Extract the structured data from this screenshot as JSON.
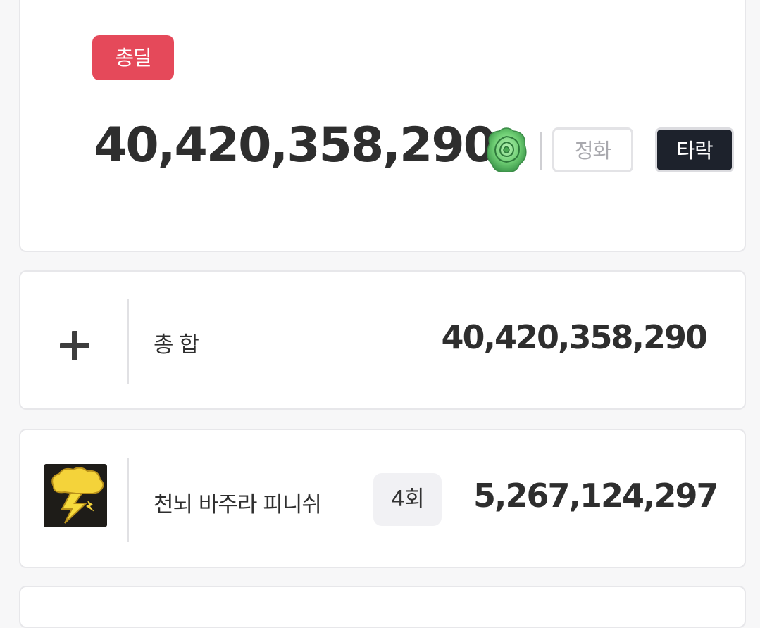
{
  "total": {
    "badge_label": "총딜",
    "value": "40,420,358,290",
    "rose_icon": "green-rose-icon",
    "purify_label": "정화",
    "corrupt_label": "타락",
    "badge_color": "#e5495a",
    "active_toggle_color": "#1d222c"
  },
  "summary": {
    "icon": "plus-icon",
    "label": "총 합",
    "value": "40,420,358,290"
  },
  "skills": [
    {
      "icon": "lightning-cloud-icon",
      "name": "천뇌 바주라 피니쉬",
      "count": "4회",
      "value": "5,267,124,297"
    }
  ]
}
